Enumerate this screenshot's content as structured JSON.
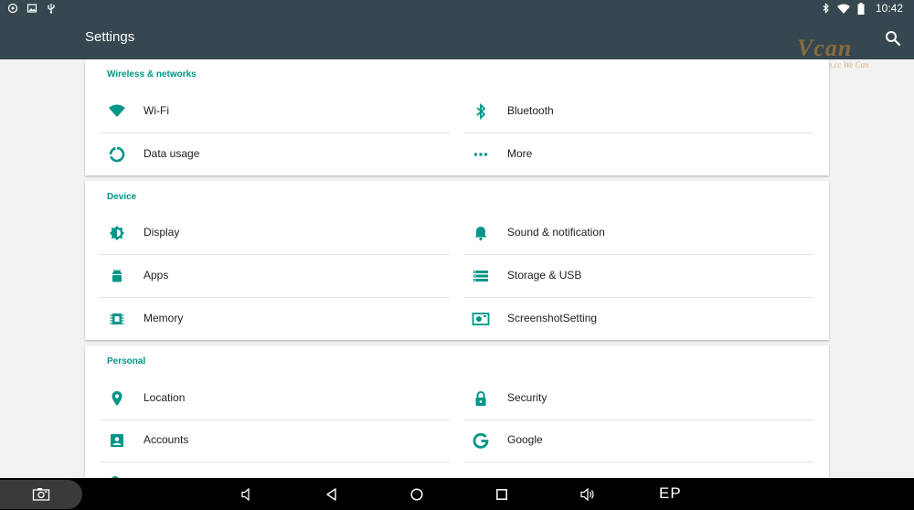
{
  "status_bar": {
    "time": "10:42",
    "left_icons": [
      "steam-notification-icon",
      "image-notification-icon",
      "usb-icon"
    ],
    "right_icons": [
      "bluetooth-status-icon",
      "wifi-status-icon",
      "battery-icon"
    ]
  },
  "app_bar": {
    "title": "Settings",
    "search_icon": "search-icon",
    "background": "#37474f"
  },
  "watermark": {
    "logo": "Vcan",
    "url": "www.Vcan.cc  We Can"
  },
  "sections": [
    {
      "header": "Wireless & networks",
      "items": [
        {
          "label": "Wi-Fi",
          "icon": "wifi-icon"
        },
        {
          "label": "Bluetooth",
          "icon": "bluetooth-icon"
        },
        {
          "label": "Data usage",
          "icon": "data-usage-icon"
        },
        {
          "label": "More",
          "icon": "more-icon"
        }
      ]
    },
    {
      "header": "Device",
      "items": [
        {
          "label": "Display",
          "icon": "brightness-icon"
        },
        {
          "label": "Sound & notification",
          "icon": "bell-icon"
        },
        {
          "label": "Apps",
          "icon": "android-icon"
        },
        {
          "label": "Storage & USB",
          "icon": "storage-icon"
        },
        {
          "label": "Memory",
          "icon": "memory-icon"
        },
        {
          "label": "ScreenshotSetting",
          "icon": "screenshot-setting-icon"
        }
      ]
    },
    {
      "header": "Personal",
      "items": [
        {
          "label": "Location",
          "icon": "location-pin-icon"
        },
        {
          "label": "Security",
          "icon": "lock-icon"
        },
        {
          "label": "Accounts",
          "icon": "account-box-icon"
        },
        {
          "label": "Google",
          "icon": "google-icon"
        }
      ]
    }
  ],
  "nav_bar": {
    "buttons": [
      "screenshot-icon",
      "volume-down-icon",
      "back-icon",
      "home-icon",
      "recents-icon",
      "volume-up-icon"
    ],
    "ep_label": "EP"
  },
  "colors": {
    "accent": "#009688",
    "icon": "#009688",
    "divider": "#e3e3e3",
    "background": "#f2f2f2"
  }
}
